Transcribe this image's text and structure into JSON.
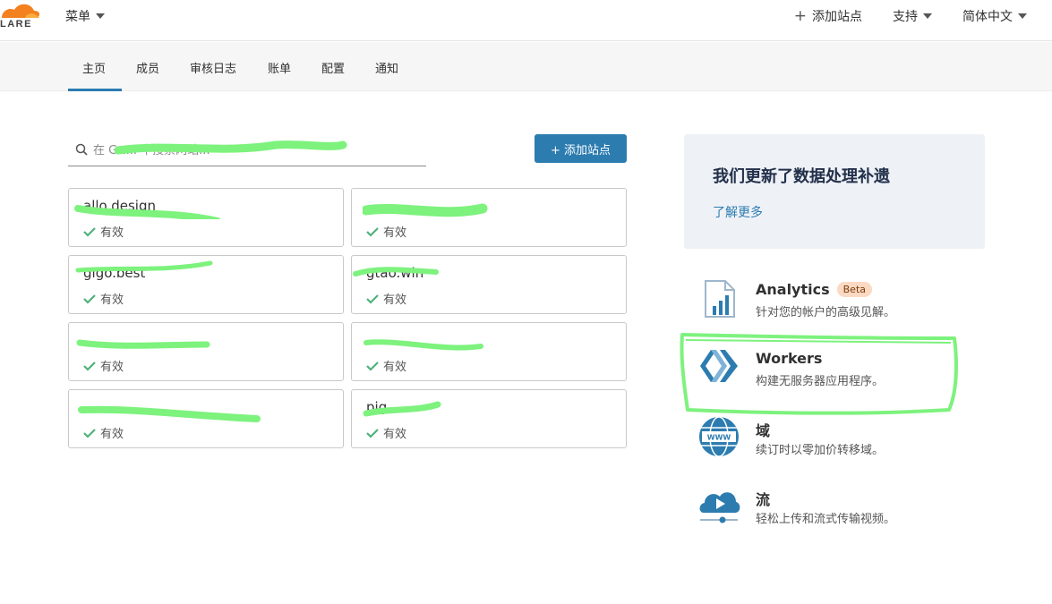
{
  "header": {
    "logo_text": "LARE",
    "menu_label": "菜单",
    "add_site_label": "添加站点",
    "support_label": "支持",
    "language_label": "简体中文"
  },
  "tabs": [
    {
      "label": "主页",
      "active": true
    },
    {
      "label": "成员"
    },
    {
      "label": "审核日志"
    },
    {
      "label": "账单"
    },
    {
      "label": "配置"
    },
    {
      "label": "通知"
    }
  ],
  "search": {
    "placeholder": "在 Gw... 中搜索网站..."
  },
  "add_button_label": "+ 添加站点",
  "sites": [
    {
      "name": "allo.design",
      "status": "有效"
    },
    {
      "name": "",
      "status": "有效"
    },
    {
      "name": "gigo.best",
      "status": "有效"
    },
    {
      "name": "gtao.win",
      "status": "有效"
    },
    {
      "name": "",
      "status": "有效"
    },
    {
      "name": "",
      "status": "有效"
    },
    {
      "name": "",
      "status": "有效"
    },
    {
      "name": "pig",
      "status": "有效"
    }
  ],
  "promo": {
    "title": "我们更新了数据处理补遗",
    "link": "了解更多"
  },
  "products": [
    {
      "title": "Analytics",
      "badge": "Beta",
      "desc": "针对您的帐户的高级见解。",
      "icon": "analytics-icon"
    },
    {
      "title": "Workers",
      "desc": "构建无服务器应用程序。",
      "icon": "workers-icon"
    },
    {
      "title": "域",
      "desc": "续订时以零加价转移域。",
      "icon": "domain-globe-icon"
    },
    {
      "title": "流",
      "desc": "轻松上传和流式传输视频。",
      "icon": "stream-icon"
    }
  ],
  "colors": {
    "accent": "#2c7cb0",
    "status_ok": "#4fb27a",
    "highlight": "#7df27d",
    "promo_bg": "#eef1f6"
  }
}
